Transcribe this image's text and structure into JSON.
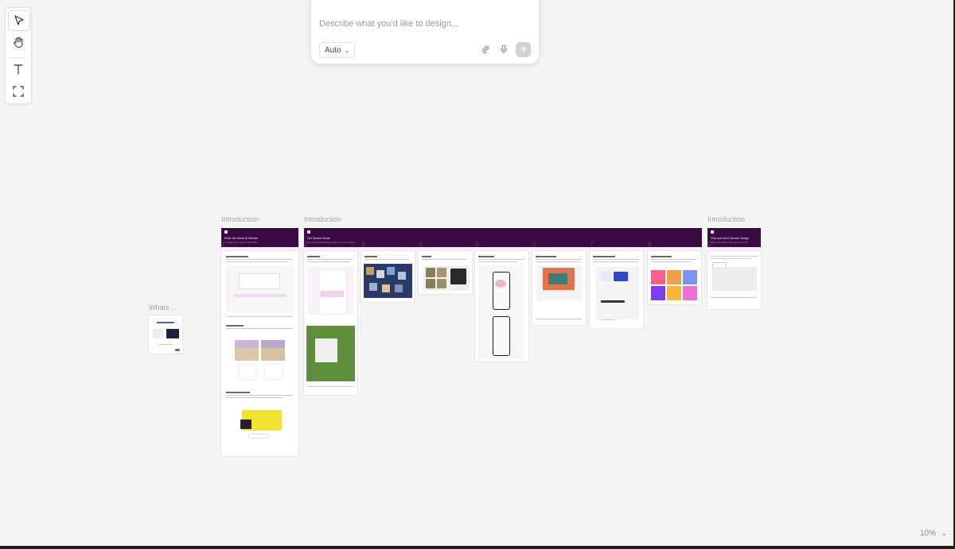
{
  "prompt": {
    "placeholder": "Describe what you'd like to design...",
    "mode": "Auto"
  },
  "toolbar": {
    "tools": [
      "select-tool",
      "hand-tool",
      "text-tool",
      "frame-tool"
    ]
  },
  "canvas": {
    "loose_label": "Whats ...",
    "sections": [
      {
        "label": "Introduction",
        "title": "Enter the World of Wonder",
        "subtitle": "A guided tour to design with Wonder"
      },
      {
        "label": "Introduction",
        "title": "Get Started Guide",
        "subtitle": "Step-by-step walkthrough of Wonder's core features"
      },
      {
        "label": "Introduction",
        "title": "Post your best Wonder design",
        "subtitle": "Share your creations with the community"
      }
    ],
    "steps": [
      "1",
      "2",
      "3",
      "4",
      "5",
      "6",
      "7",
      "8",
      "9"
    ]
  },
  "zoom": {
    "level": "10%"
  },
  "colors": {
    "banner": "#3b0a45",
    "canvas_bg": "#f4f4f4",
    "send_button": "#d2d2d2"
  }
}
